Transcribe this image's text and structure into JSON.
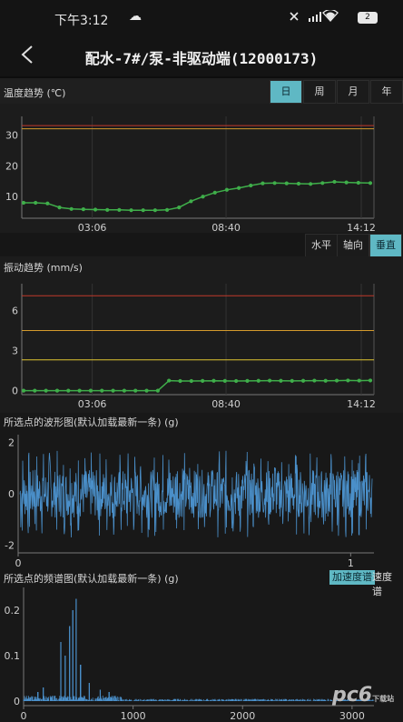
{
  "status_bar": {
    "time": "下午3:12",
    "battery": "2"
  },
  "header": {
    "back_icon": "chevron-left-icon",
    "title": "配水-7#/泵-非驱动端(12000173)"
  },
  "temperature": {
    "title": "温度趋势 (℃)",
    "tabs": [
      {
        "label": "日",
        "active": true
      },
      {
        "label": "周",
        "active": false
      },
      {
        "label": "月",
        "active": false
      },
      {
        "label": "年",
        "active": false
      }
    ],
    "chart_data": {
      "type": "line",
      "y_ticks": [
        "10",
        "20",
        "30"
      ],
      "x_ticks": [
        "03:06",
        "08:40",
        "14:12"
      ],
      "ylim": [
        3,
        36
      ],
      "thresholds": [
        {
          "value": 33,
          "color": "#c0392b"
        },
        {
          "value": 32,
          "color": "#d39a2c"
        }
      ],
      "series": [
        {
          "color": "#3fae4a",
          "values": [
            8,
            8,
            7.8,
            6.5,
            6,
            5.9,
            5.8,
            5.7,
            5.7,
            5.6,
            5.6,
            5.6,
            5.7,
            6.5,
            8.5,
            10,
            11.3,
            12.2,
            12.8,
            13.6,
            14.3,
            14.4,
            14.3,
            14.2,
            14.1,
            14.4,
            14.8,
            14.6,
            14.5,
            14.4
          ]
        }
      ]
    }
  },
  "vibration": {
    "axes": [
      {
        "label": "水平",
        "active": false
      },
      {
        "label": "轴向",
        "active": false
      },
      {
        "label": "垂直",
        "active": true
      }
    ],
    "title": "振动趋势 (mm/s)",
    "chart_data": {
      "type": "line",
      "y_ticks": [
        "0",
        "3",
        "6"
      ],
      "x_ticks": [
        "03:06",
        "08:40",
        "14:12"
      ],
      "ylim": [
        -0.3,
        8
      ],
      "thresholds": [
        {
          "value": 7.1,
          "color": "#c0392b"
        },
        {
          "value": 4.5,
          "color": "#d39a2c"
        },
        {
          "value": 2.3,
          "color": "#e0c531"
        }
      ],
      "series": [
        {
          "color": "#3fae4a",
          "values": [
            0,
            0,
            0,
            0,
            0,
            0,
            0,
            0,
            0,
            0,
            0,
            0,
            0,
            0.75,
            0.72,
            0.72,
            0.73,
            0.74,
            0.73,
            0.72,
            0.73,
            0.74,
            0.75,
            0.74,
            0.73,
            0.74,
            0.75,
            0.74,
            0.75,
            0.76,
            0.75,
            0.76
          ]
        }
      ]
    }
  },
  "waveform": {
    "title": "所选点的波形图(默认加载最新一条) (g)",
    "chart_data": {
      "type": "line",
      "y_ticks": [
        "-2",
        "0",
        "2"
      ],
      "x_ticks": [
        "0",
        "1"
      ],
      "ylim": [
        -2.3,
        2.3
      ],
      "xlim": [
        0,
        1.07
      ],
      "amplitude": 1.7,
      "color": "#4a8fc9"
    }
  },
  "spectrum": {
    "title": "所选点的频谱图(默认加载最新一条) (g)",
    "toggles": [
      {
        "label": "加速度谱",
        "active": true
      },
      {
        "label": "速度谱",
        "active": false
      }
    ],
    "chart_data": {
      "type": "line",
      "y_ticks": [
        "0",
        "0.1",
        "0.2"
      ],
      "x_ticks": [
        "0",
        "1000",
        "2000",
        "3000"
      ],
      "xlim": [
        0,
        3200
      ],
      "ylim": [
        -0.01,
        0.25
      ],
      "peaks": [
        {
          "x": 340,
          "y": 0.13
        },
        {
          "x": 380,
          "y": 0.1
        },
        {
          "x": 420,
          "y": 0.165
        },
        {
          "x": 450,
          "y": 0.2
        },
        {
          "x": 480,
          "y": 0.225
        },
        {
          "x": 520,
          "y": 0.08
        },
        {
          "x": 600,
          "y": 0.04
        },
        {
          "x": 180,
          "y": 0.03
        },
        {
          "x": 130,
          "y": 0.02
        },
        {
          "x": 700,
          "y": 0.025
        },
        {
          "x": 780,
          "y": 0.02
        }
      ],
      "color": "#4a8fc9"
    }
  },
  "watermark": {
    "text": "pc6",
    "sub": "下载站"
  }
}
